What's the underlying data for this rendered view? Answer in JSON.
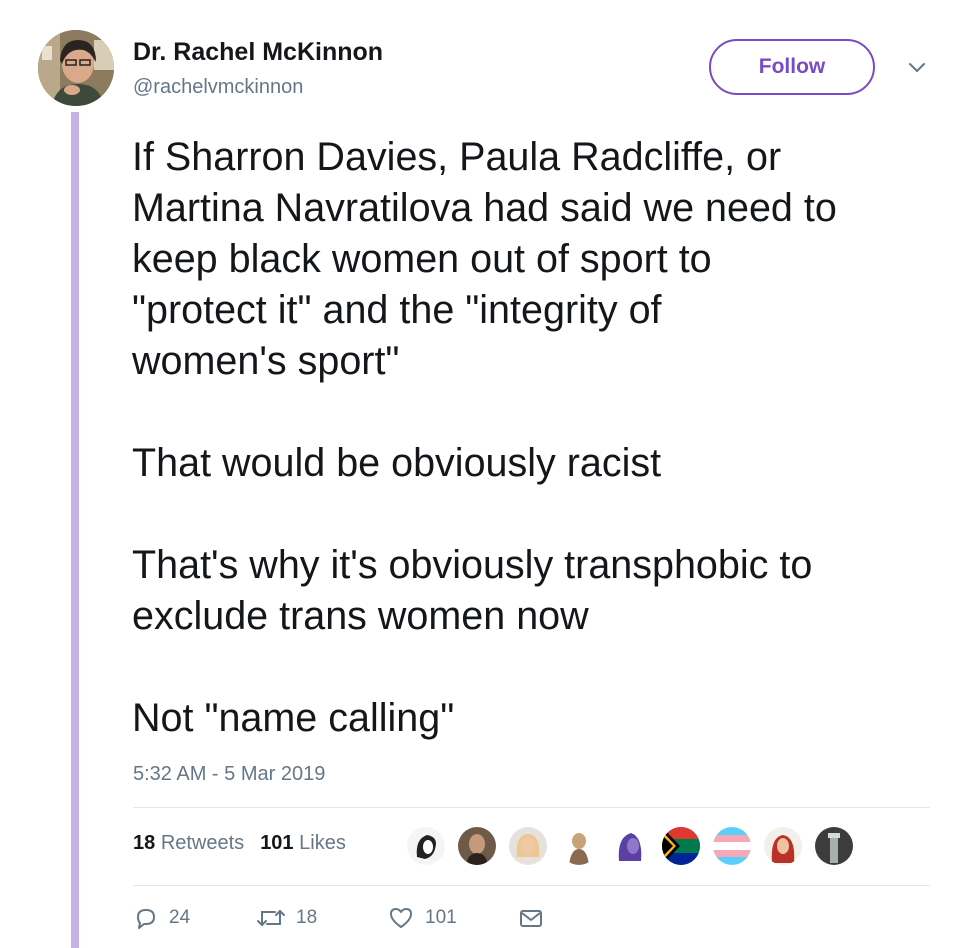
{
  "user": {
    "display_name": "Dr. Rachel McKinnon",
    "handle": "@rachelvmckinnon"
  },
  "follow_label": "Follow",
  "tweet": {
    "lines": [
      "If Sharron Davies, Paula Radcliffe, or",
      "Martina Navratilova had said we need to",
      "keep black women out of sport to",
      "\"protect it\" and the \"integrity of",
      "women's sport\"",
      "",
      "That would be obviously racist",
      "",
      "That's why it's obviously transphobic to",
      "exclude trans women now",
      "",
      "Not \"name calling\""
    ],
    "timestamp": "5:32 AM - 5 Mar 2019"
  },
  "stats": {
    "retweets_count": "18",
    "retweets_label": "Retweets",
    "likes_count": "101",
    "likes_label": "Likes"
  },
  "likers": [
    {
      "icon": "liker-avatar-1",
      "color": "#f2f2f2"
    },
    {
      "icon": "liker-avatar-2",
      "color": "#5a4636"
    },
    {
      "icon": "liker-avatar-3",
      "color": "#e8cfae"
    },
    {
      "icon": "liker-avatar-4",
      "color": "#c9a27a"
    },
    {
      "icon": "liker-avatar-5",
      "color": "#5b3fa3"
    },
    {
      "icon": "south-africa-flag-avatar",
      "color": "#007a4d"
    },
    {
      "icon": "trans-flag-avatar",
      "color": "#5bcefa"
    },
    {
      "icon": "liker-avatar-8",
      "color": "#b83226"
    },
    {
      "icon": "liker-avatar-9",
      "color": "#3c3c3c"
    }
  ],
  "actions": {
    "reply_count": "24",
    "retweet_count": "18",
    "like_count": "101"
  },
  "colors": {
    "accent": "#794bc4",
    "thread_line": "#c5b2e6",
    "muted_text": "#657786",
    "divider": "#e1e8ed"
  }
}
